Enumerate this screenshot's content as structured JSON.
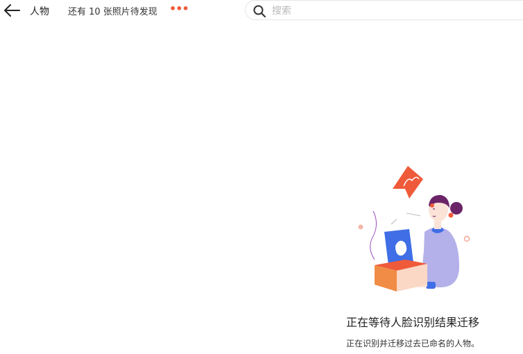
{
  "header": {
    "title": "人物",
    "pending_text": "还有 10 张照片待发现",
    "more_label": "•••"
  },
  "search": {
    "placeholder": "搜索",
    "value": ""
  },
  "empty_state": {
    "title": "正在等待人脸识别结果迁移",
    "description": "正在识别并迁移过去已命名的人物。"
  },
  "colors": {
    "accent": "#ef5a3a",
    "illustration_purple": "#b3b0ea",
    "illustration_blue": "#3f6ee6",
    "illustration_orange": "#f08c45",
    "hair": "#6b2468"
  },
  "icons": {
    "back": "arrow-left-icon",
    "more": "more-dots-icon",
    "search": "magnifier-icon"
  }
}
